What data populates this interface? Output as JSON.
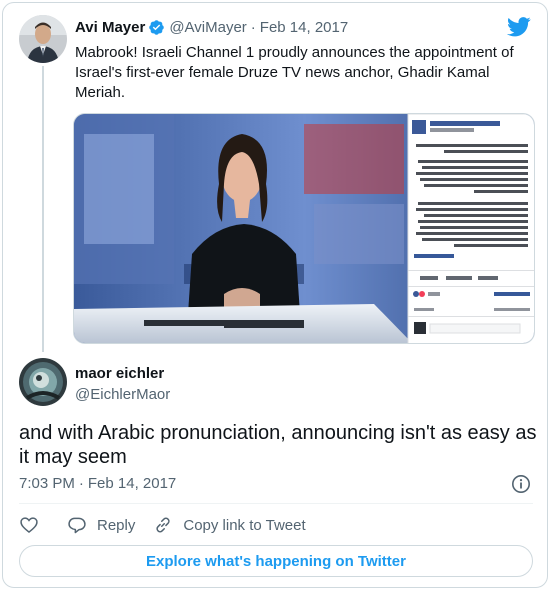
{
  "colors": {
    "brand": "#1d9bf0",
    "text": "#0f1419",
    "muted": "#536471",
    "border": "#cfd9de"
  },
  "icons": {
    "logo": "twitter-bird-icon",
    "verified": "verified-badge-icon",
    "info": "info-icon",
    "like": "heart-icon",
    "reply": "reply-icon",
    "copy": "link-icon"
  },
  "tweet1": {
    "name": "Avi Mayer",
    "handle": "@AviMayer",
    "date": "Feb 14, 2017",
    "text": "Mabrook! Israeli Channel 1 proudly announces the appointment of Israel's first-ever female Druze TV news anchor, Ghadir Kamal Meriah."
  },
  "media": {
    "page_name": "Channel 1 Israel - ערוץ הראשון",
    "page_sub": "Like This Page · 23 mins ·",
    "see_translation": "See Translation",
    "reactions": [
      "Like",
      "Comment",
      "Share"
    ],
    "reaction_count": "94",
    "top_comments": "Top Comments ▾",
    "shares": "2 shares",
    "comments": "12 Comments",
    "write_comment": "Write a comment..."
  },
  "tweet2": {
    "name": "maor eichler",
    "handle": "@EichlerMaor",
    "text": "and with Arabic pronunciation, announcing isn't as easy as it may seem",
    "time": "7:03 PM",
    "date": "Feb 14, 2017"
  },
  "actions": {
    "reply": "Reply",
    "copy": "Copy link to Tweet"
  },
  "explore": "Explore what's happening on Twitter"
}
